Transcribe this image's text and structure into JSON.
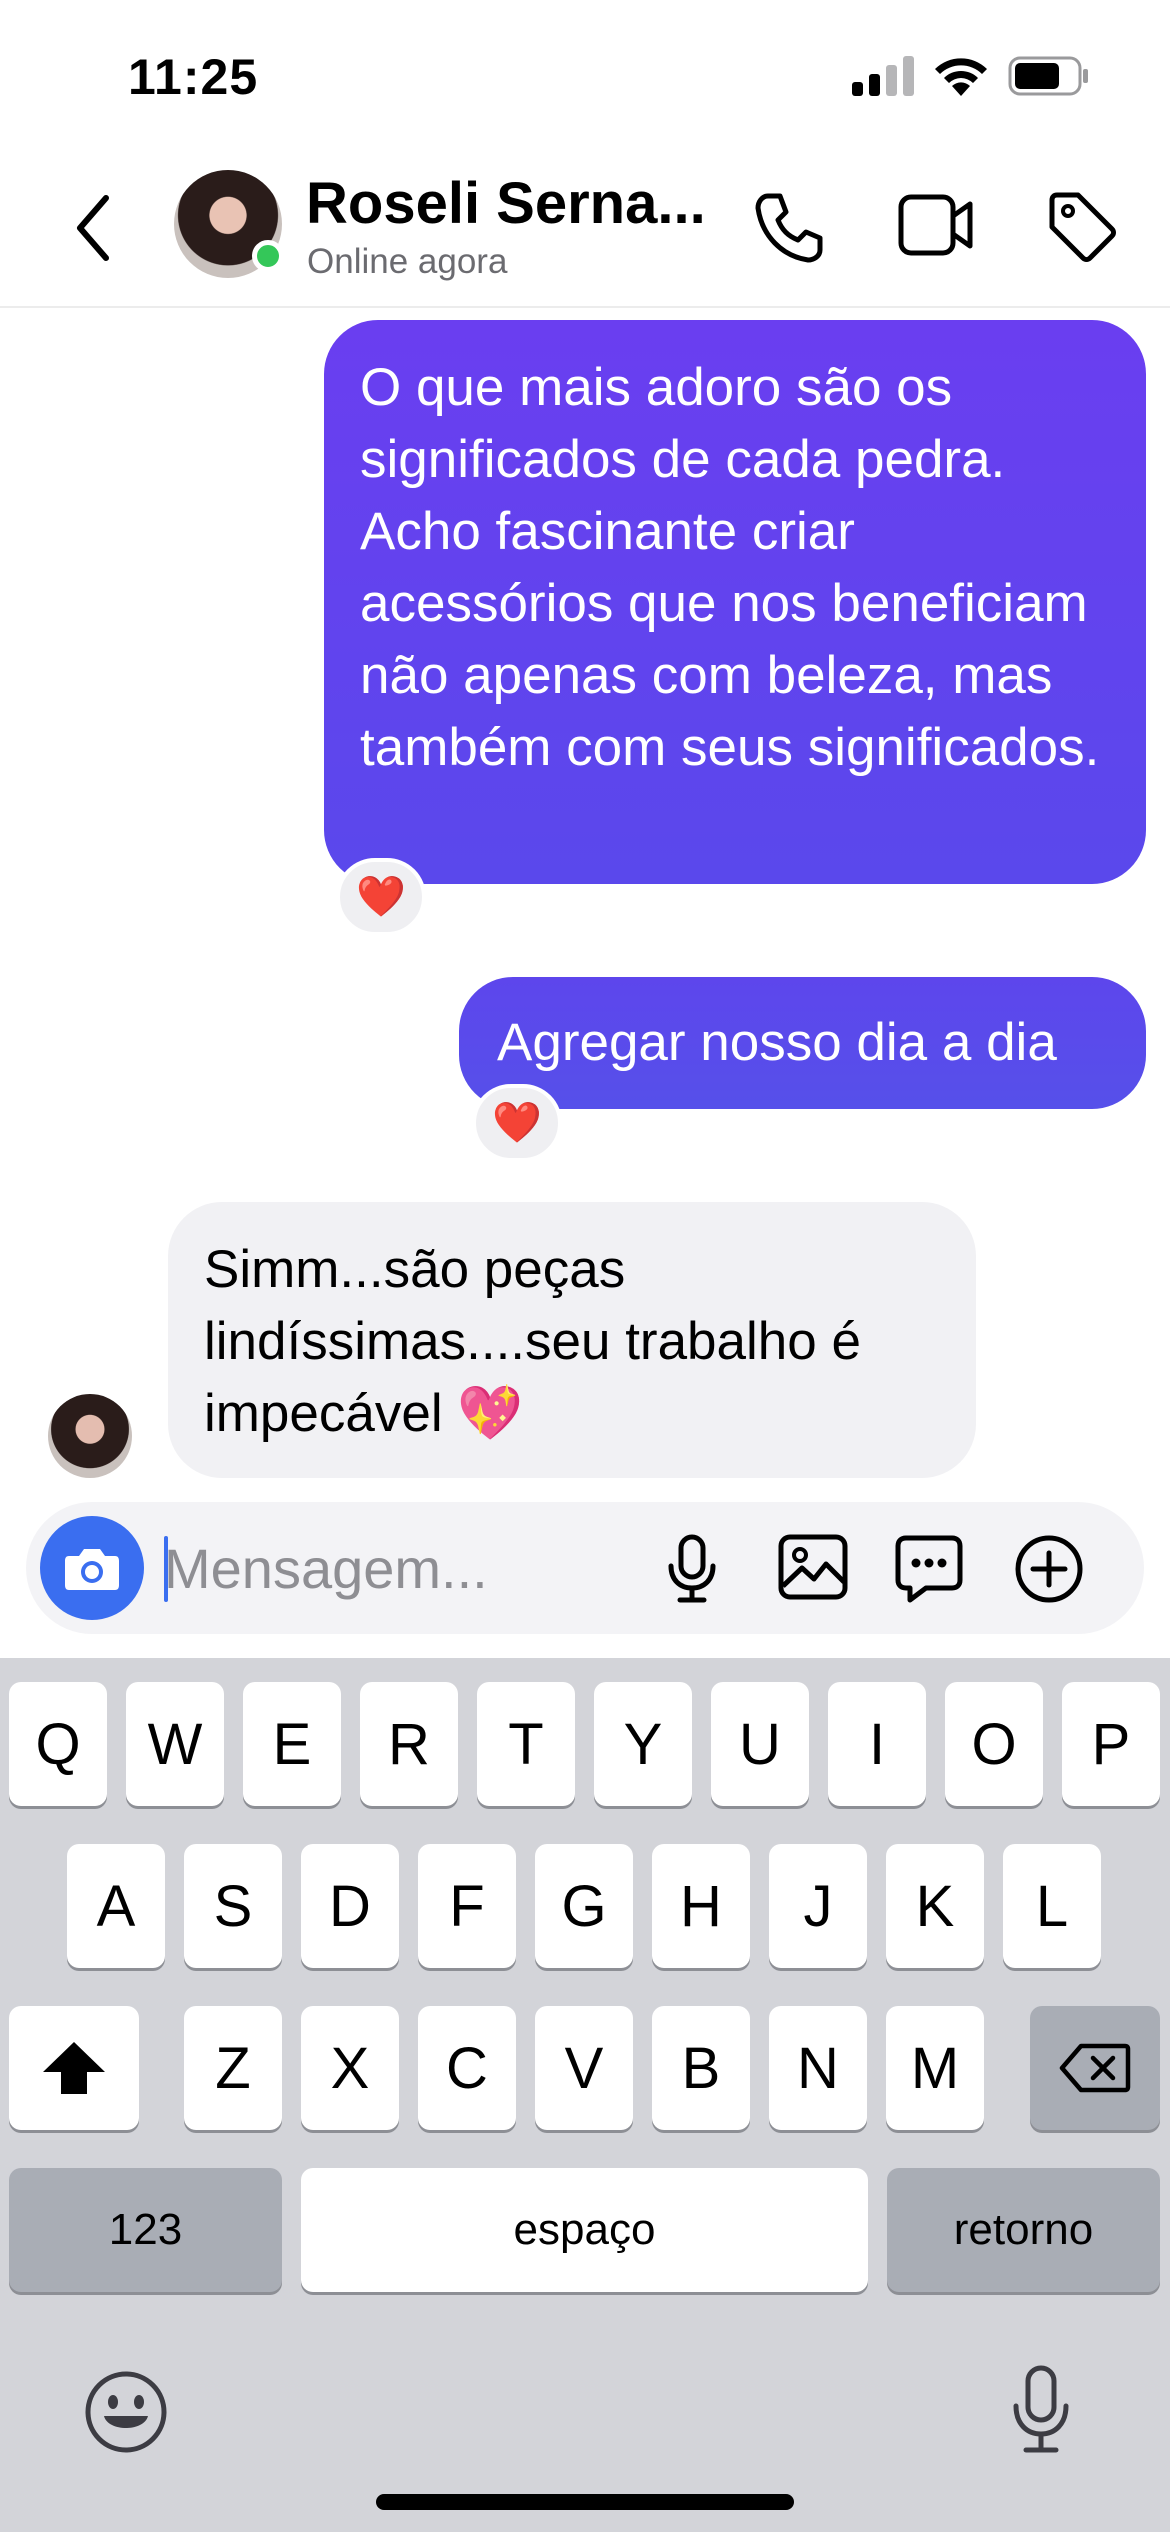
{
  "status_bar": {
    "time": "11:25"
  },
  "header": {
    "contact_name": "Roseli Serna...",
    "contact_status": "Online agora"
  },
  "messages": [
    {
      "direction": "outgoing",
      "text": "O que mais adoro são os significados de cada pedra. Acho fascinante criar acessórios que nos beneficiam não apenas com beleza, mas também com seus significados.",
      "reaction": "❤️"
    },
    {
      "direction": "outgoing",
      "text": "Agregar nosso dia a dia",
      "reaction": "❤️"
    },
    {
      "direction": "incoming",
      "text": "Simm...são peças lindíssimas....seu trabalho é impecável 💖"
    }
  ],
  "composer": {
    "placeholder": "Mensagem..."
  },
  "keyboard": {
    "row1": [
      "Q",
      "W",
      "E",
      "R",
      "T",
      "Y",
      "U",
      "I",
      "O",
      "P"
    ],
    "row2": [
      "A",
      "S",
      "D",
      "F",
      "G",
      "H",
      "J",
      "K",
      "L"
    ],
    "row3": [
      "Z",
      "X",
      "C",
      "V",
      "B",
      "N",
      "M"
    ],
    "numbers_label": "123",
    "space_label": "espaço",
    "return_label": "retorno"
  },
  "colors": {
    "outgoing_bubble": "#5f44ee",
    "incoming_bubble": "#f1f1f4",
    "camera_button": "#3a6ef0",
    "online_dot": "#34c759",
    "keyboard_bg": "#d3d4d9"
  }
}
